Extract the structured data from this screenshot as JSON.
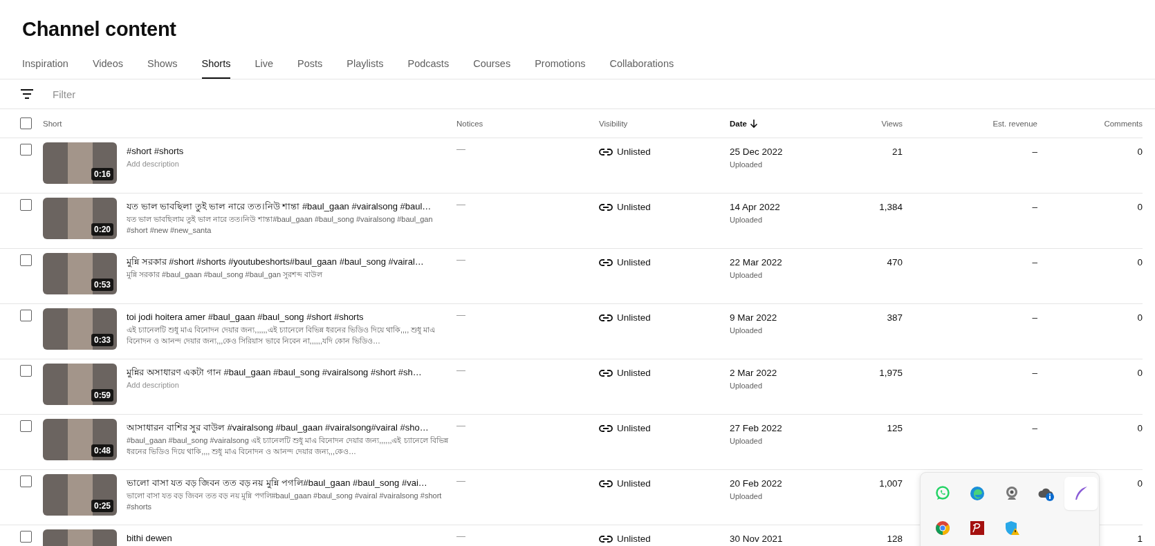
{
  "page": {
    "title": "Channel content"
  },
  "tabs": [
    {
      "label": "Inspiration",
      "selected": false
    },
    {
      "label": "Videos",
      "selected": false
    },
    {
      "label": "Shows",
      "selected": false
    },
    {
      "label": "Shorts",
      "selected": true
    },
    {
      "label": "Live",
      "selected": false
    },
    {
      "label": "Posts",
      "selected": false
    },
    {
      "label": "Playlists",
      "selected": false
    },
    {
      "label": "Podcasts",
      "selected": false
    },
    {
      "label": "Courses",
      "selected": false
    },
    {
      "label": "Promotions",
      "selected": false
    },
    {
      "label": "Collaborations",
      "selected": false
    }
  ],
  "filter": {
    "placeholder": "Filter"
  },
  "table": {
    "select_all": {
      "checked": false
    },
    "columns": [
      {
        "label": "Short",
        "sorted": false
      },
      {
        "label": "Notices",
        "sorted": false
      },
      {
        "label": "Visibility",
        "sorted": false
      },
      {
        "label": "Date",
        "sorted": true
      },
      {
        "label": "Views",
        "sorted": false
      },
      {
        "label": "Est. revenue",
        "sorted": false
      },
      {
        "label": "Comments",
        "sorted": false
      }
    ],
    "rows": [
      {
        "checked": false,
        "duration": "0:16",
        "title": "#short #shorts",
        "description": "Add description",
        "description_empty": true,
        "notices": "—",
        "visibility": "Unlisted",
        "date": "25 Dec 2022",
        "date_status": "Uploaded",
        "views": "21",
        "revenue": "–",
        "comments": "0"
      },
      {
        "checked": false,
        "duration": "0:20",
        "title": "যত ভাল ভাবছিলা তুই ভাল নারে তত।নিউ শান্তা #baul_gaan #vairalsong #baul…",
        "description": "যত ভাল ভাবছিলাম তুই ভাল নারে তত।নিউ শান্তা#baul_gaan #baul_song #vairalsong #baul_gan #short #new #new_santa",
        "description_empty": false,
        "notices": "—",
        "visibility": "Unlisted",
        "date": "14 Apr 2022",
        "date_status": "Uploaded",
        "views": "1,384",
        "revenue": "–",
        "comments": "0"
      },
      {
        "checked": false,
        "duration": "0:53",
        "title": "মুন্নি সরকার #short #shorts #youtubeshorts#baul_gaan #baul_song #vairal…",
        "description": "মুন্নি সরকার #baul_gaan #baul_song #baul_gan সুরশব্দ বাউল",
        "description_empty": false,
        "notices": "—",
        "visibility": "Unlisted",
        "date": "22 Mar 2022",
        "date_status": "Uploaded",
        "views": "470",
        "revenue": "–",
        "comments": "0"
      },
      {
        "checked": false,
        "duration": "0:33",
        "title": "toi jodi hoitera amer #baul_gaan #baul_song #short #shorts",
        "description": "এই চ্যানেলটি শুধু মাএ বিনোদন দেয়ার জন্য,,,,,,এই চ্যানেলে বিভিন্ন ধরনের ভিডিও দিয়ে থাকি,,,, শুধু মাএ বিনোদন ও আনন্দ দেয়ার জন্য,,,কেও সিরিয়াস ভাবে নিবেন না,,,,,,যদি কোন ভিডিও…",
        "description_empty": false,
        "notices": "—",
        "visibility": "Unlisted",
        "date": "9 Mar 2022",
        "date_status": "Uploaded",
        "views": "387",
        "revenue": "–",
        "comments": "0"
      },
      {
        "checked": false,
        "duration": "0:59",
        "title": "মুন্নির অসাধারণ একটা গান #baul_gaan #baul_song #vairalsong #short #sh…",
        "description": "Add description",
        "description_empty": true,
        "notices": "—",
        "visibility": "Unlisted",
        "date": "2 Mar 2022",
        "date_status": "Uploaded",
        "views": "1,975",
        "revenue": "–",
        "comments": "0"
      },
      {
        "checked": false,
        "duration": "0:48",
        "title": "আসাধারন বাশির সুর বাউল #vairalsong #baul_gaan #vairalsong#vairal #sho…",
        "description": "#baul_gaan #baul_song #vairalsong এই চ্যানেলটি শুধু মাএ বিনোদন দেয়ার জন্য,,,,,,এই চ্যানেলে বিভিন্ন ধরনের ভিডিও দিয়ে থাকি,,,, শুধু মাএ বিনোদন ও আনন্দ দেয়ার জন্য,,,কেও…",
        "description_empty": false,
        "notices": "—",
        "visibility": "Unlisted",
        "date": "27 Feb 2022",
        "date_status": "Uploaded",
        "views": "125",
        "revenue": "–",
        "comments": "0"
      },
      {
        "checked": false,
        "duration": "0:25",
        "title": "ভালো বাসা যত বড় জিবন তত বড় নয় মুন্নি পগলি#baul_gaan #baul_song #vai…",
        "description": "ভালো বাসা যত বড় জিবন তত বড় নয় মুন্নি পগলি#baul_gaan #baul_song #vairal #vairalsong #short #shorts",
        "description_empty": false,
        "notices": "—",
        "visibility": "Unlisted",
        "date": "20 Feb 2022",
        "date_status": "Uploaded",
        "views": "1,007",
        "comments": "0"
      },
      {
        "checked": false,
        "title": "bithi dewen",
        "notices": "—",
        "visibility": "Unlisted",
        "date": "30 Nov 2021",
        "views": "128",
        "comments": "1"
      }
    ]
  },
  "tray": {
    "items": [
      {
        "selected": false
      },
      {
        "selected": false
      },
      {
        "selected": false
      },
      {
        "selected": false
      },
      {
        "selected": true
      },
      {
        "selected": false
      },
      {
        "selected": false
      },
      {
        "selected": false
      }
    ]
  }
}
